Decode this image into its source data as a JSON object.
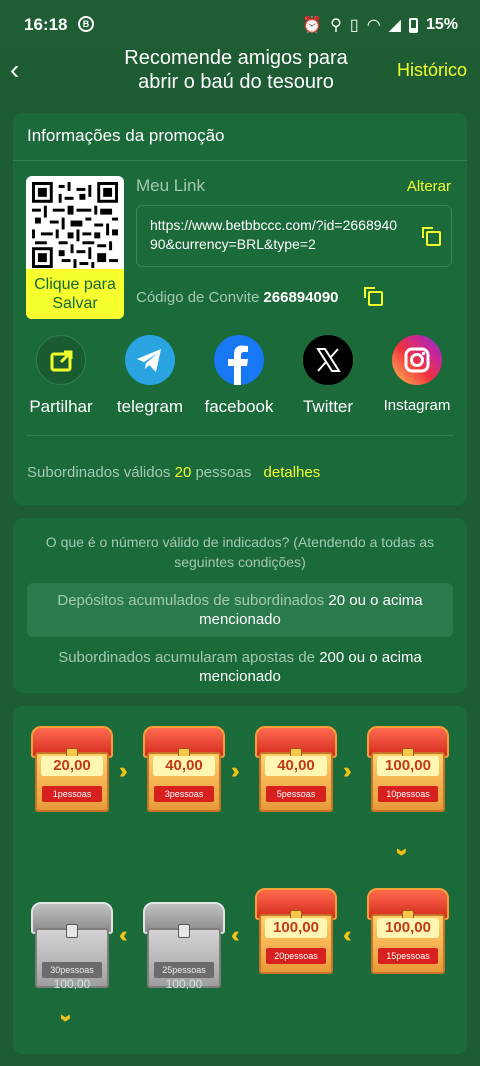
{
  "status_bar": {
    "time": "16:18",
    "battery": "15%"
  },
  "header": {
    "title_line1": "Recomende amigos para",
    "title_line2": "abrir o baú do tesouro",
    "history_label": "Histórico"
  },
  "promo": {
    "section_title": "Informações da promoção",
    "save_label_1": "Clique para",
    "save_label_2": "Salvar",
    "my_link_label": "Meu Link",
    "change_label": "Alterar",
    "link_url": "https://www.betbbccc.com/?id=266894090&currency=BRL&type=2",
    "invite_code_label": "Código de Convite",
    "invite_code": "266894090",
    "share": [
      {
        "label": "Partilhar",
        "icon": "share-icon"
      },
      {
        "label": "telegram",
        "icon": "telegram-icon"
      },
      {
        "label": "facebook",
        "icon": "facebook-icon"
      },
      {
        "label": "Twitter",
        "icon": "twitter-x-icon"
      },
      {
        "label": "Instagram",
        "icon": "instagram-icon"
      }
    ],
    "valid_subs_prefix": "Subordinados válidos",
    "valid_subs_count": "20",
    "valid_subs_suffix": "pessoas",
    "details_label": "detalhes"
  },
  "conditions": {
    "question": "O que é o número válido de indicados? (Atendendo a todas as seguintes condições)",
    "cond1_prefix": "Depósitos acumulados de subordinados",
    "cond1_value": "20",
    "cond1_suffix": "ou o acima mencionado",
    "cond2_prefix": "Subordinados acumularam apostas de",
    "cond2_value": "200",
    "cond2_suffix": "ou o acima mencionado"
  },
  "chests": [
    {
      "amount": "20,00",
      "people": "1pessoas",
      "state": "gold"
    },
    {
      "amount": "40,00",
      "people": "3pessoas",
      "state": "gold"
    },
    {
      "amount": "40,00",
      "people": "5pessoas",
      "state": "gold"
    },
    {
      "amount": "100,00",
      "people": "10pessoas",
      "state": "gold"
    },
    {
      "amount": "100,00",
      "people": "15pessoas",
      "state": "gold"
    },
    {
      "amount": "100,00",
      "people": "20pessoas",
      "state": "gold"
    },
    {
      "amount": "100,00",
      "people": "25pessoas",
      "state": "locked"
    },
    {
      "amount": "100,00",
      "people": "30pessoas",
      "state": "locked"
    }
  ],
  "colors": {
    "background": "#1e5c33",
    "card": "#1b6a3a",
    "accent": "#f2ff2a"
  }
}
